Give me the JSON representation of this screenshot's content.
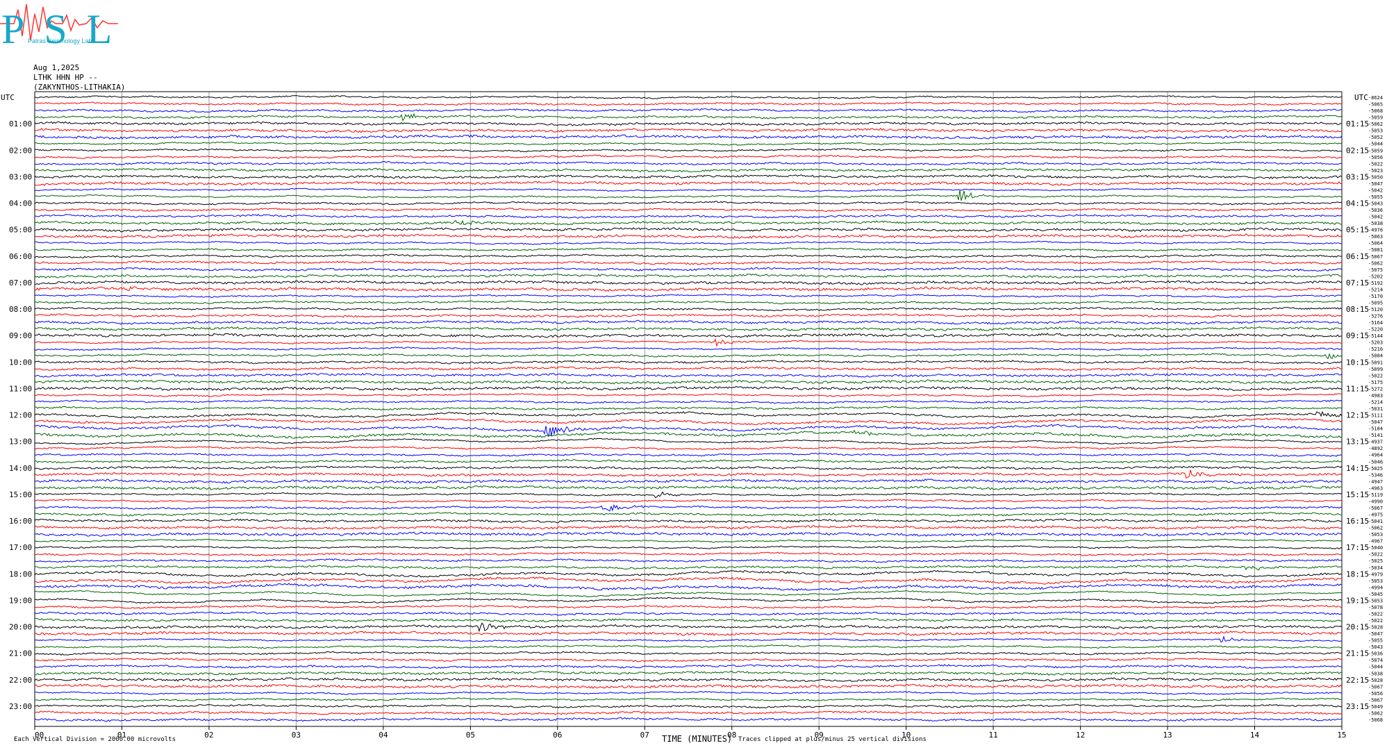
{
  "header": {
    "date": "Aug 1,2025",
    "station": "LTHK HHN HP --",
    "location": "(ZAKYNTHOS-LITHAKIA)",
    "logo_letters": "PSL",
    "logo_text": "Patras Seismology Lab"
  },
  "footer": {
    "division_note": "Each Vertical Division = 2000.00 microvolts",
    "clip_note": "Traces clipped at plus/minus 25 vertical divisions"
  },
  "chart_data": {
    "type": "line",
    "title": "",
    "xlabel": "TIME (MINUTES)",
    "ylabel": "UTC",
    "right_label": "UTC",
    "xlim": [
      0,
      15
    ],
    "x_ticks": [
      "00",
      "01",
      "02",
      "03",
      "04",
      "05",
      "06",
      "07",
      "08",
      "09",
      "10",
      "11",
      "12",
      "13",
      "14",
      "15"
    ],
    "grid": true,
    "rows_per_hour": 4,
    "row_colors": [
      "#000000",
      "#ff0000",
      "#0000ff",
      "#006400"
    ],
    "left_hour_labels": [
      "01:00",
      "02:00",
      "03:00",
      "04:00",
      "05:00",
      "06:00",
      "07:00",
      "08:00",
      "09:00",
      "10:00",
      "11:00",
      "12:00",
      "13:00",
      "14:00",
      "15:00",
      "16:00",
      "17:00",
      "18:00",
      "19:00",
      "20:00",
      "21:00",
      "22:00",
      "23:00"
    ],
    "right_hour_labels": [
      "01:15",
      "02:15",
      "03:15",
      "04:15",
      "05:15",
      "06:15",
      "07:15",
      "08:15",
      "09:15",
      "10:15",
      "11:15",
      "12:15",
      "13:15",
      "14:15",
      "15:15",
      "16:15",
      "17:15",
      "18:15",
      "19:15",
      "20:15",
      "21:15",
      "22:15",
      "23:15"
    ],
    "row_means": [
      "-8624",
      "-5065",
      "-5068",
      "-5059",
      "-5062",
      "-5053",
      "-5052",
      "-5044",
      "-5059",
      "-5056",
      "-5022",
      "-5023",
      "-5050",
      "-5047",
      "-5042",
      "-5055",
      "-5043",
      "-5036",
      "-5042",
      "-5038",
      "-4976",
      "-5063",
      "-5064",
      "-5081",
      "-5067",
      "-5062",
      "-5075",
      "-5202",
      "-5192",
      "-5214",
      "-5170",
      "-5095",
      "-5120",
      "-5276",
      "-5164",
      "-5220",
      "-5144",
      "-5203",
      "-5216",
      "-5084",
      "-5091",
      "-5099",
      "-5022",
      "-5175",
      "-5272",
      "-4983",
      "-5214",
      "-5031",
      "-5111",
      "-5047",
      "-5184",
      "-5141",
      "-4937",
      "-4892",
      "-4964",
      "-5046",
      "-5025",
      "-5346",
      "-4947",
      "-4963",
      "-5119",
      "-4990",
      "-5067",
      "-4975",
      "-5041",
      "-5062",
      "-5053",
      "-4967",
      "-5040",
      "-5022",
      "-5025",
      "-5034",
      "-4979",
      "-5053",
      "-4994",
      "-5045",
      "-5053",
      "-5078",
      "-5022",
      "-5022",
      "-5028",
      "-5047",
      "-5055",
      "-5043",
      "-5036",
      "-5074",
      "-5044",
      "-5038",
      "-5028",
      "-5067",
      "-5056",
      "-5067",
      "-5049",
      "-5062",
      "-5068"
    ],
    "events": [
      {
        "row": 3,
        "minute": 4.2,
        "amplitude": 3.2
      },
      {
        "row": 5,
        "minute": 3.3,
        "amplitude": 1.5
      },
      {
        "row": 15,
        "minute": 10.6,
        "amplitude": 5.0
      },
      {
        "row": 19,
        "minute": 4.8,
        "amplitude": 3.5
      },
      {
        "row": 29,
        "minute": 1.0,
        "amplitude": 2.0
      },
      {
        "row": 37,
        "minute": 7.8,
        "amplitude": 2.5
      },
      {
        "row": 39,
        "minute": 14.8,
        "amplitude": 2.5
      },
      {
        "row": 48,
        "minute": 14.7,
        "amplitude": 3.0
      },
      {
        "row": 50,
        "minute": 5.85,
        "amplitude": 5.0
      },
      {
        "row": 57,
        "minute": 13.2,
        "amplitude": 3.5
      },
      {
        "row": 60,
        "minute": 7.1,
        "amplitude": 3.0
      },
      {
        "row": 62,
        "minute": 6.5,
        "amplitude": 4.5
      },
      {
        "row": 80,
        "minute": 5.1,
        "amplitude": 3.5
      },
      {
        "row": 82,
        "minute": 13.6,
        "amplitude": 2.0
      },
      {
        "row": 71,
        "minute": 13.9,
        "amplitude": 2.0
      },
      {
        "row": 51,
        "minute": 9.4,
        "amplitude": 2.0
      },
      {
        "row": 76,
        "minute": 10.2,
        "amplitude": 1.5
      }
    ]
  }
}
